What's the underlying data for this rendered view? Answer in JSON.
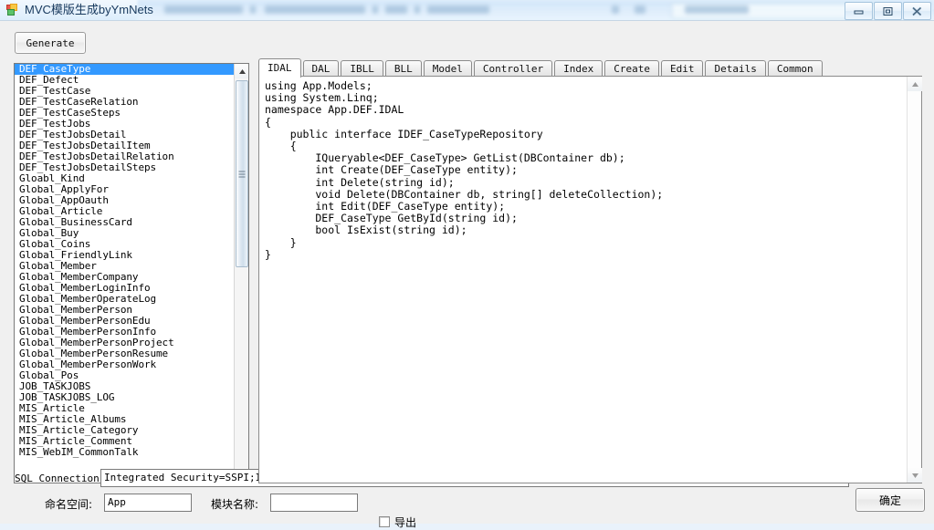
{
  "window": {
    "title": "MVC模版生成byYmNets",
    "icon": "app-icon",
    "buttons": {
      "minimize": "minimize-icon",
      "maximize": "maximize-icon",
      "close": "close-icon"
    }
  },
  "toolbar": {
    "generate_label": "Generate"
  },
  "listbox": {
    "selected": "DEF_CaseType",
    "items": [
      "DEF_CaseType",
      "DEF_Defect",
      "DEF_TestCase",
      "DEF_TestCaseRelation",
      "DEF_TestCaseSteps",
      "DEF_TestJobs",
      "DEF_TestJobsDetail",
      "DEF_TestJobsDetailItem",
      "DEF_TestJobsDetailRelation",
      "DEF_TestJobsDetailSteps",
      "Gloabl_Kind",
      "Global_ApplyFor",
      "Global_AppOauth",
      "Global_Article",
      "Global_BusinessCard",
      "Global_Buy",
      "Global_Coins",
      "Global_FriendlyLink",
      "Global_Member",
      "Global_MemberCompany",
      "Global_MemberLoginInfo",
      "Global_MemberOperateLog",
      "Global_MemberPerson",
      "Global_MemberPersonEdu",
      "Global_MemberPersonInfo",
      "Global_MemberPersonProject",
      "Global_MemberPersonResume",
      "Global_MemberPersonWork",
      "Global_Pos",
      "JOB_TASKJOBS",
      "JOB_TASKJOBS_LOG",
      "MIS_Article",
      "MIS_Article_Albums",
      "MIS_Article_Category",
      "MIS_Article_Comment",
      "MIS_WebIM_CommonTalk"
    ]
  },
  "tabs": {
    "active": "IDAL",
    "items": [
      {
        "label": "IDAL"
      },
      {
        "label": "DAL"
      },
      {
        "label": "IBLL"
      },
      {
        "label": "BLL"
      },
      {
        "label": "Model"
      },
      {
        "label": "Controller"
      },
      {
        "label": "Index"
      },
      {
        "label": "Create"
      },
      {
        "label": "Edit"
      },
      {
        "label": "Details"
      },
      {
        "label": "Common"
      }
    ]
  },
  "editor": {
    "code": "using App.Models;\nusing System.Linq;\nnamespace App.DEF.IDAL\n{\n    public interface IDEF_CaseTypeRepository\n    {\n        IQueryable<DEF_CaseType> GetList(DBContainer db);\n        int Create(DEF_CaseType entity);\n        int Delete(string id);\n        void Delete(DBContainer db, string[] deleteCollection);\n        int Edit(DEF_CaseType entity);\n        DEF_CaseType GetById(string id);\n        bool IsExist(string id);\n    }\n}"
  },
  "form": {
    "sql_connection_label": "SQL Connection:",
    "sql_connection_value": "Integrated Security=SSPI;Initial Catalog='HrDB';Data Source='.';User ID='sa';Password='zhaoyun123!@#';Connect Timeout=40",
    "ok_label": "确定",
    "namespace_label": "命名空间:",
    "namespace_value": "App",
    "module_label": "模块名称:",
    "module_value": "",
    "export_label": "导出",
    "export_checked": false
  },
  "colors": {
    "selection": "#3399ff",
    "window_chrome": "#f0f0f0",
    "title_text": "#16385c"
  }
}
